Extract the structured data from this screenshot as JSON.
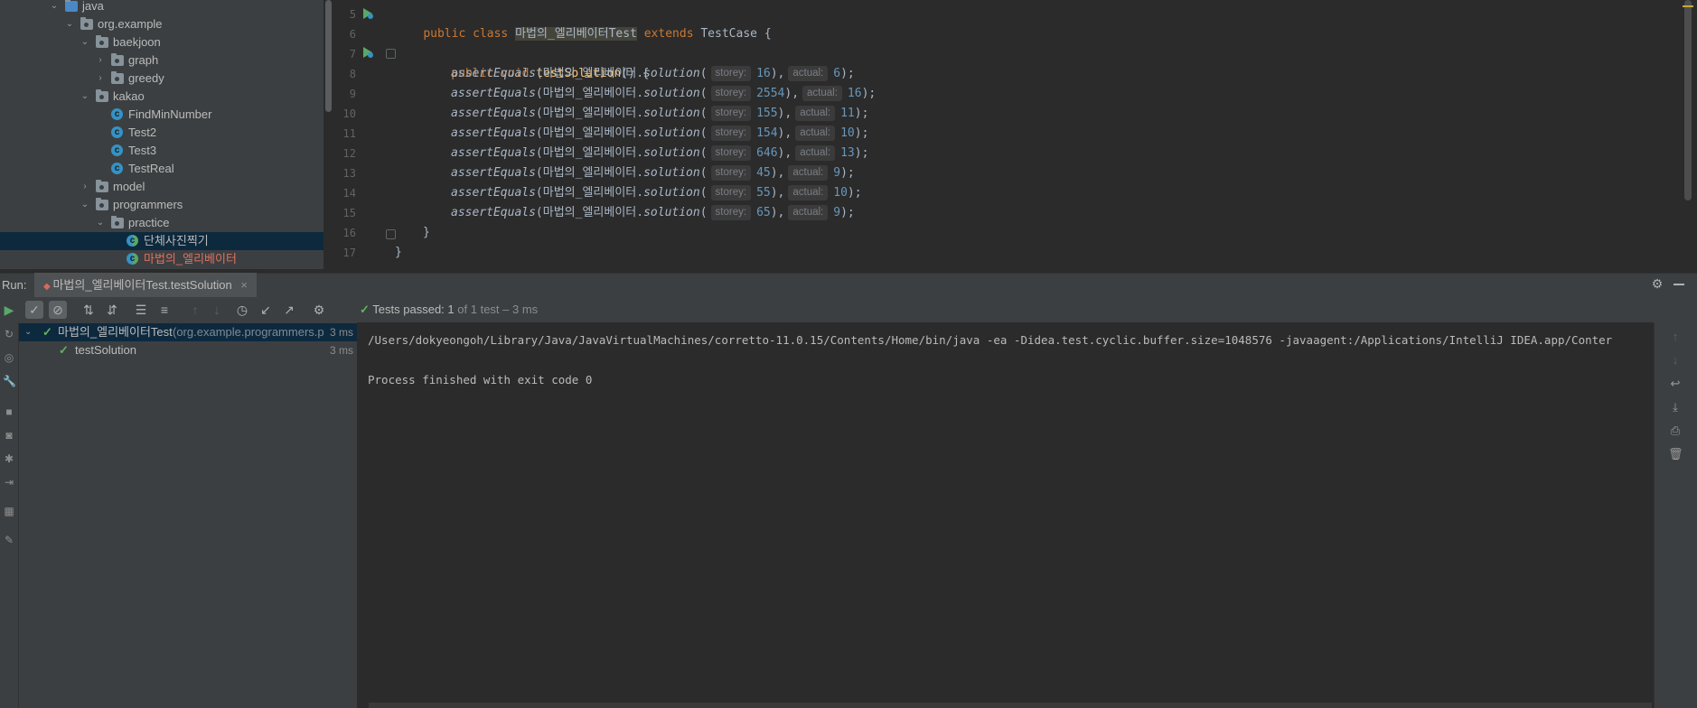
{
  "project_tree": {
    "items": [
      {
        "label": "java",
        "type": "folder-blue",
        "depth": 3,
        "expanded": true
      },
      {
        "label": "org.example",
        "type": "package",
        "depth": 4,
        "expanded": true
      },
      {
        "label": "baekjoon",
        "type": "package",
        "depth": 5,
        "expanded": true
      },
      {
        "label": "graph",
        "type": "package",
        "depth": 6,
        "expanded": false
      },
      {
        "label": "greedy",
        "type": "package",
        "depth": 6,
        "expanded": false
      },
      {
        "label": "kakao",
        "type": "package",
        "depth": 5,
        "expanded": true
      },
      {
        "label": "FindMinNumber",
        "type": "class",
        "depth": 6
      },
      {
        "label": "Test2",
        "type": "class",
        "depth": 6
      },
      {
        "label": "Test3",
        "type": "class",
        "depth": 6
      },
      {
        "label": "TestReal",
        "type": "class",
        "depth": 6
      },
      {
        "label": "model",
        "type": "package",
        "depth": 5,
        "expanded": false
      },
      {
        "label": "programmers",
        "type": "package",
        "depth": 5,
        "expanded": true
      },
      {
        "label": "practice",
        "type": "package",
        "depth": 6,
        "expanded": true
      },
      {
        "label": "단체사진찍기",
        "type": "class-test",
        "depth": 7,
        "selected": true
      },
      {
        "label": "마법의_엘리베이터",
        "type": "class-test",
        "depth": 7,
        "color": "#e0705f"
      }
    ]
  },
  "editor": {
    "lines": [
      {
        "n": "5"
      },
      {
        "n": "6"
      },
      {
        "n": "7"
      },
      {
        "n": "8"
      },
      {
        "n": "9"
      },
      {
        "n": "10"
      },
      {
        "n": "11"
      },
      {
        "n": "12"
      },
      {
        "n": "13"
      },
      {
        "n": "14"
      },
      {
        "n": "15"
      },
      {
        "n": "16"
      },
      {
        "n": "17"
      }
    ],
    "class_decl": {
      "kw1": "public",
      "kw2": "class",
      "name": "마법의_엘리베이터Test",
      "kw3": "extends",
      "parent": "TestCase",
      "brace": "{"
    },
    "method_decl": {
      "kw1": "public",
      "kw2": "void",
      "name": "testSolution",
      "rest": "() {"
    },
    "asserts": [
      {
        "call": "assertEquals",
        "target": "마법의_엘리베이터",
        "method": "solution",
        "hint1": "storey:",
        "arg1": "16",
        "hint2": "actual:",
        "arg2": "6"
      },
      {
        "call": "assertEquals",
        "target": "마법의_엘리베이터",
        "method": "solution",
        "hint1": "storey:",
        "arg1": "2554",
        "hint2": "actual:",
        "arg2": "16"
      },
      {
        "call": "assertEquals",
        "target": "마법의_엘리베이터",
        "method": "solution",
        "hint1": "storey:",
        "arg1": "155",
        "hint2": "actual:",
        "arg2": "11"
      },
      {
        "call": "assertEquals",
        "target": "마법의_엘리베이터",
        "method": "solution",
        "hint1": "storey:",
        "arg1": "154",
        "hint2": "actual:",
        "arg2": "10"
      },
      {
        "call": "assertEquals",
        "target": "마법의_엘리베이터",
        "method": "solution",
        "hint1": "storey:",
        "arg1": "646",
        "hint2": "actual:",
        "arg2": "13"
      },
      {
        "call": "assertEquals",
        "target": "마법의_엘리베이터",
        "method": "solution",
        "hint1": "storey:",
        "arg1": "45",
        "hint2": "actual:",
        "arg2": "9"
      },
      {
        "call": "assertEquals",
        "target": "마법의_엘리베이터",
        "method": "solution",
        "hint1": "storey:",
        "arg1": "55",
        "hint2": "actual:",
        "arg2": "10"
      },
      {
        "call": "assertEquals",
        "target": "마법의_엘리베이터",
        "method": "solution",
        "hint1": "storey:",
        "arg1": "65",
        "hint2": "actual:",
        "arg2": "9"
      }
    ],
    "close_method": "}",
    "close_class": "}"
  },
  "run_panel": {
    "label": "Run:",
    "tab_title": "마법의_엘리베이터Test.testSolution",
    "tab_close": "×",
    "status": {
      "prefix": "Tests passed:",
      "passed": "1",
      "rest": "of 1 test – 3 ms"
    },
    "tests": [
      {
        "name": "마법의_엘리베이터Test",
        "pkg": "(org.example.programmers.p",
        "time": "3 ms"
      },
      {
        "name": "testSolution",
        "time": "3 ms"
      }
    ],
    "console": [
      "/Users/dokyeongoh/Library/Java/JavaVirtualMachines/corretto-11.0.15/Contents/Home/bin/java -ea -Didea.test.cyclic.buffer.size=1048576 -javaagent:/Applications/IntelliJ IDEA.app/Conter",
      "",
      "Process finished with exit code 0"
    ]
  },
  "colors": {
    "accent": "#5fb35f",
    "selection": "#0d293e",
    "keyword": "#cc7832",
    "number": "#6897bb"
  }
}
